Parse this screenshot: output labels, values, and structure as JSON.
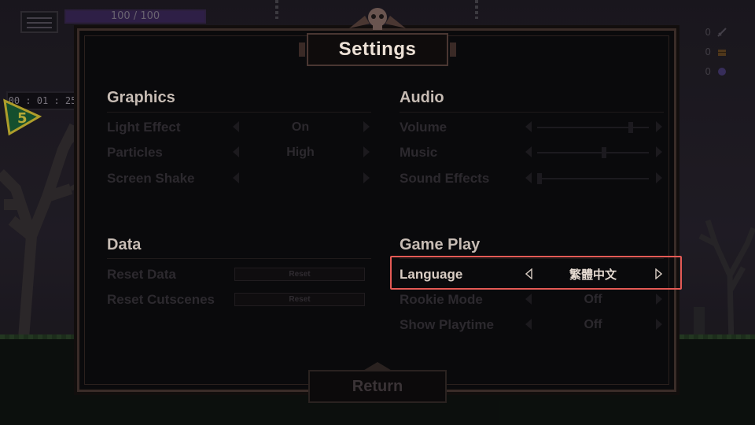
{
  "hud": {
    "health_text": "100 / 100",
    "health_fraction": 1.0,
    "timer": "00 : 01 : 25",
    "level": "5",
    "counters": [
      {
        "icon": "sword-icon",
        "value": "0",
        "color": "#5a5560"
      },
      {
        "icon": "chest-icon",
        "value": "0",
        "color": "#6a4a24"
      },
      {
        "icon": "orb-icon",
        "value": "0",
        "color": "#4a3d78"
      }
    ]
  },
  "settings": {
    "title": "Settings",
    "return_label": "Return",
    "graphics": {
      "title": "Graphics",
      "rows": [
        {
          "label": "Light Effect",
          "value": "On"
        },
        {
          "label": "Particles",
          "value": "High"
        },
        {
          "label": "Screen Shake",
          "value": ""
        }
      ]
    },
    "audio": {
      "title": "Audio",
      "rows": [
        {
          "label": "Volume",
          "level": 0.85
        },
        {
          "label": "Music",
          "level": 0.6
        },
        {
          "label": "Sound Effects",
          "level": 0.0
        }
      ]
    },
    "data": {
      "title": "Data",
      "rows": [
        {
          "label": "Reset Data",
          "button": "Reset"
        },
        {
          "label": "Reset Cutscenes",
          "button": "Reset"
        }
      ]
    },
    "gameplay": {
      "title": "Game Play",
      "rows": [
        {
          "label": "Language",
          "value": "繁體中文"
        },
        {
          "label": "Rookie Mode",
          "value": "Off"
        },
        {
          "label": "Show Playtime",
          "value": "Off"
        }
      ]
    }
  },
  "colors": {
    "highlight": "#e45a55",
    "title_text": "#ede1d6",
    "panel_border": "#3a2c28"
  }
}
